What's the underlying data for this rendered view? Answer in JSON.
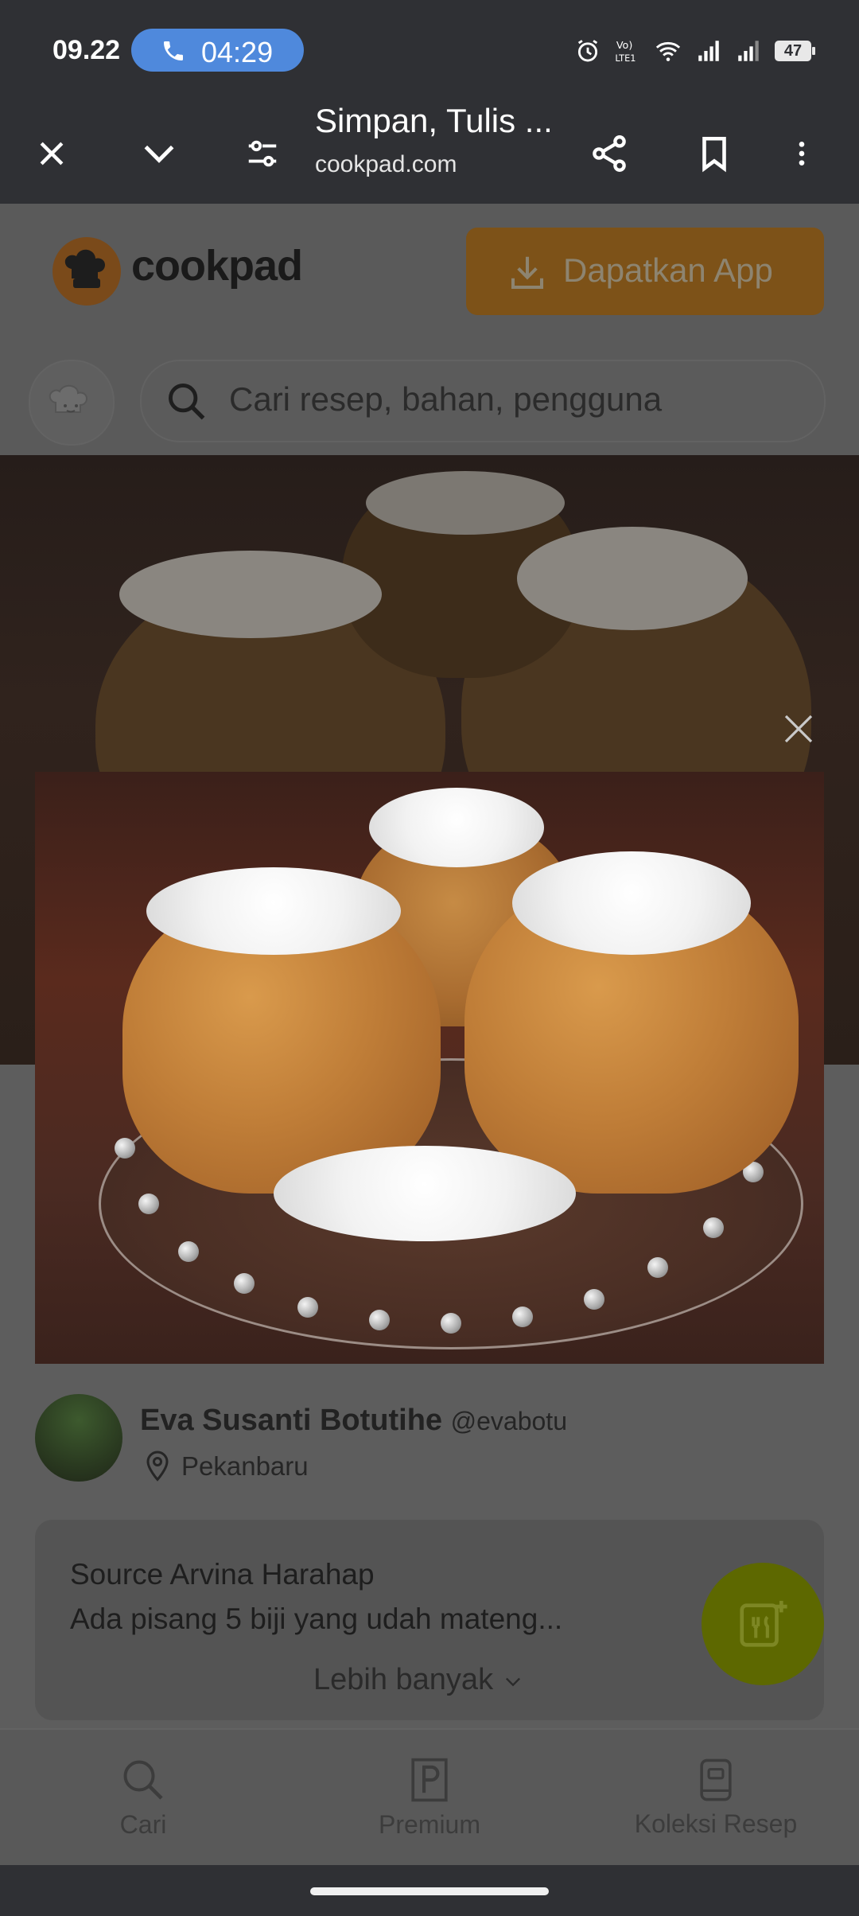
{
  "status_bar": {
    "time": "09.22",
    "call_duration": "04:29",
    "battery": "47",
    "icons": [
      "alarm-icon",
      "volte-icon",
      "wifi-icon",
      "signal-icon",
      "signal-icon",
      "battery-icon"
    ]
  },
  "browser": {
    "page_title": "Simpan, Tulis ...",
    "domain": "cookpad.com",
    "icons": [
      "close-icon",
      "chevron-down-icon",
      "tune-icon",
      "share-icon",
      "bookmark-icon",
      "more-vert-icon"
    ]
  },
  "site": {
    "logo_text": "cookpad",
    "get_app_label": "Dapatkan App",
    "search_placeholder": "Cari resep, bahan, pengguna"
  },
  "author": {
    "name": "Eva Susanti Botutihe",
    "handle": "@evabotu",
    "location": "Pekanbaru"
  },
  "description": {
    "line1": "Source Arvina Harahap",
    "line2": "Ada pisang 5 biji yang udah mateng...",
    "more_label": "Lebih banyak"
  },
  "bottom_nav": {
    "items": [
      {
        "label": "Cari",
        "icon": "search-icon"
      },
      {
        "label": "Premium",
        "icon": "premium-icon"
      },
      {
        "label": "Koleksi Resep",
        "icon": "collection-icon"
      }
    ]
  },
  "colors": {
    "chrome_bg": "#2f3034",
    "call_pill": "#4f89dc",
    "overlay_page": "#5d5d5d",
    "fab": "#5d6800"
  }
}
